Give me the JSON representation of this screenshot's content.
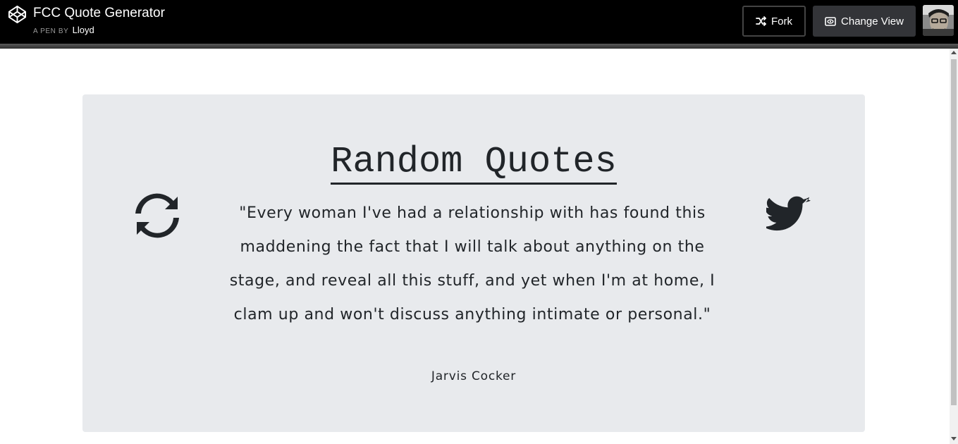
{
  "header": {
    "pen_title": "FCC Quote Generator",
    "byline_prefix": "A PEN BY",
    "author": "Lloyd",
    "fork_label": "Fork",
    "change_view_label": "Change View",
    "logo_icon": "codepen-logo-icon",
    "fork_icon": "fork-icon",
    "change_view_icon": "change-view-icon"
  },
  "card": {
    "heading": "Random Quotes",
    "quote": "\"Every woman I've had a relationship with has found this maddening the fact that I will talk about anything on the stage, and reveal all this stuff, and yet when I'm at home, I clam up and won't discuss anything intimate or personal.\"",
    "author": "Jarvis Cocker",
    "refresh_icon": "refresh-icon",
    "tweet_icon": "twitter-icon"
  },
  "colors": {
    "topbar_bg": "#000000",
    "card_bg": "#e8eaed",
    "text": "#212529",
    "change_view_bg": "#333438"
  }
}
